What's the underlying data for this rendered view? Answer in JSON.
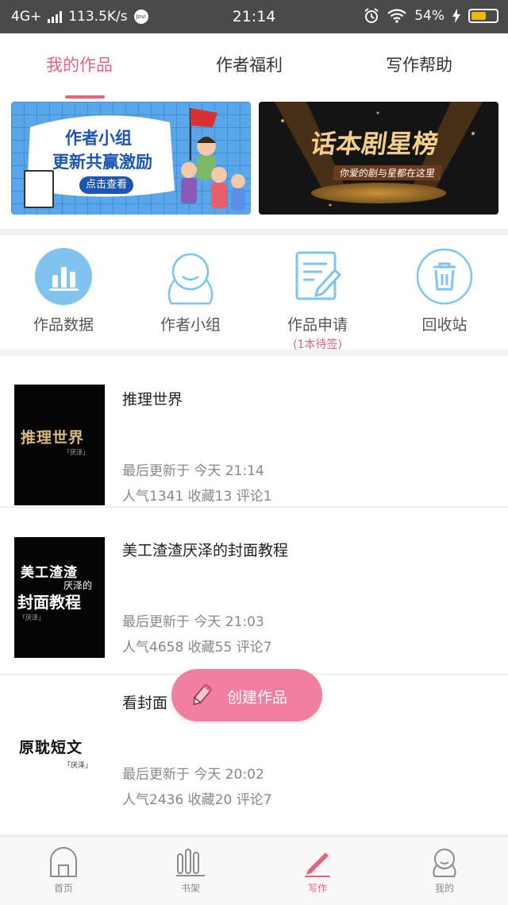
{
  "status_bar": {
    "network": "4G+",
    "speed": "113.5K/s",
    "jovi": "Jovi",
    "time": "21:14",
    "battery": "54%"
  },
  "top_tabs": [
    {
      "label": "我的作品"
    },
    {
      "label": "作者福利"
    },
    {
      "label": "写作帮助"
    }
  ],
  "banners": {
    "left": {
      "line1": "作者小组",
      "line2": "更新共赢激励",
      "button": "点击查看"
    },
    "right": {
      "title": "话本剧星榜",
      "subtitle": "你爱的剧与星都在这里"
    }
  },
  "quick_actions": [
    {
      "label": "作品数据"
    },
    {
      "label": "作者小组"
    },
    {
      "label": "作品申请",
      "sub": "(1本待签)"
    },
    {
      "label": "回收站"
    }
  ],
  "works": [
    {
      "title": "推理世界",
      "updated": "最后更新于  今天  21:14",
      "stats": "人气1341 收藏13 评论1",
      "cover_title": "推理世界",
      "cover_author": "「厌泽」"
    },
    {
      "title": "美工渣渣厌泽的封面教程",
      "updated": "最后更新于  今天  21:03",
      "stats": "人气4658 收藏55 评论7",
      "cover_line1": "美工渣渣",
      "cover_line2": "厌泽的",
      "cover_line3": "封面教程",
      "cover_author": "「厌泽」"
    },
    {
      "title": "看封面",
      "updated": "最后更新于  今天  20:02",
      "stats": "人气2436 收藏20 评论7",
      "cover_title": "原耽短文",
      "cover_author": "「厌泽」"
    }
  ],
  "fab": {
    "label": "创建作品"
  },
  "bottom_nav": [
    {
      "label": "首页"
    },
    {
      "label": "书架"
    },
    {
      "label": "写作"
    },
    {
      "label": "我的"
    }
  ],
  "colors": {
    "accent": "#e4647f",
    "fab": "#f27ea0",
    "icon_blue": "#7ec4ee",
    "status_bar": "#4a4a4a"
  }
}
